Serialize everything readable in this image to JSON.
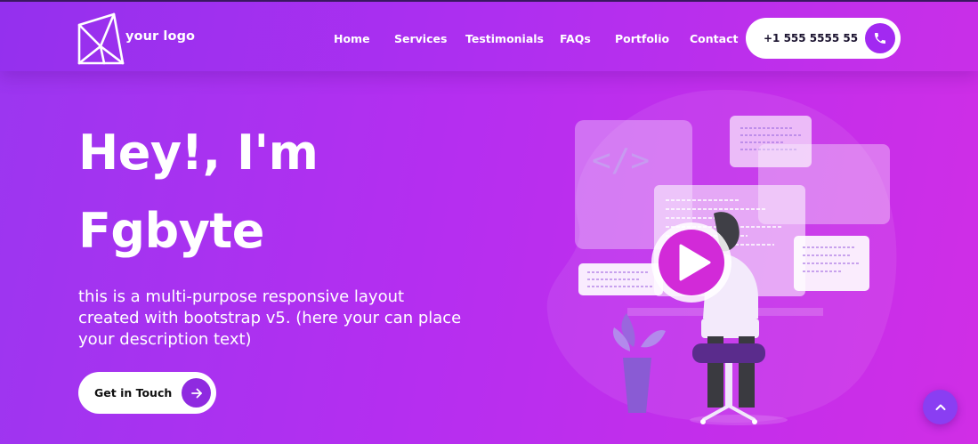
{
  "brand": {
    "logo_text": "your logo"
  },
  "nav": {
    "items": [
      {
        "label": "Home"
      },
      {
        "label": "Services"
      },
      {
        "label": "Testimonials"
      },
      {
        "label": "FAQs"
      },
      {
        "label": "Portfolio"
      },
      {
        "label": "Contact"
      }
    ]
  },
  "phone": {
    "number": "+1 555 5555 55",
    "icon": "phone-icon"
  },
  "hero": {
    "line1": "Hey!, I'm",
    "line2": "Fgbyte",
    "description": "this is a multi-purpose responsive layout created with bootstrap v5. (here your can place your description text)",
    "cta_label": "Get in Touch",
    "cta_icon": "arrow-right-icon"
  },
  "illustration": {
    "code_symbol": "</>"
  },
  "scroll_top": {
    "icon": "chevron-up-icon"
  },
  "colors": {
    "accent": "#a229f1",
    "gradient_start": "#9b36f0",
    "gradient_end": "#d02ee6",
    "text": "#ffffff"
  }
}
